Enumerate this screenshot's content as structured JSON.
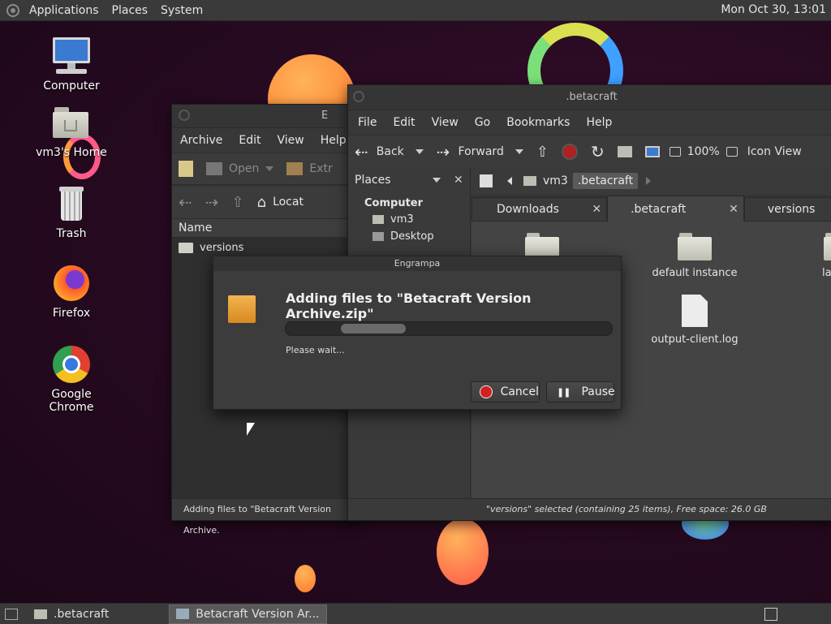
{
  "top_panel": {
    "menus": [
      "Applications",
      "Places",
      "System"
    ],
    "clock": "Mon Oct 30, 13:01"
  },
  "desktop_icons": [
    {
      "label": "Computer"
    },
    {
      "label": "vm3's Home"
    },
    {
      "label": "Trash"
    },
    {
      "label": "Firefox"
    },
    {
      "label": "Google Chrome"
    }
  ],
  "engrampa_window": {
    "title": "E",
    "menus": [
      "Archive",
      "Edit",
      "View",
      "Help"
    ],
    "toolbar": {
      "new": "",
      "open": "Open",
      "extract": "Extr"
    },
    "location_label": "Locat",
    "column_name": "Name",
    "row_name": "versions",
    "status": "Adding files to \"Betacraft Version Archive."
  },
  "caja_window": {
    "title": ".betacraft",
    "menus": [
      "File",
      "Edit",
      "View",
      "Go",
      "Bookmarks",
      "Help"
    ],
    "toolbar": {
      "back": "Back",
      "forward": "Forward",
      "zoom": "100%",
      "view_mode": "Icon View"
    },
    "sidebar": {
      "selector": "Places",
      "heading": "Computer",
      "items": [
        "vm3",
        "Desktop"
      ]
    },
    "path": [
      "vm3",
      ".betacraft"
    ],
    "tabs": [
      "Downloads",
      ".betacraft",
      "versions"
    ],
    "files": [
      "default instance",
      "output-client.log",
      "la"
    ],
    "status": "\"versions\" selected (containing 25 items), Free space: 26.0 GB"
  },
  "dialog": {
    "title": "Engrampa",
    "heading": "Adding files to \"Betacraft Version Archive.zip\"",
    "status": "Please wait...",
    "cancel": "Cancel",
    "pause": "Pause"
  },
  "taskbar": {
    "tasks": [
      ".betacraft",
      "Betacraft Version Ar..."
    ]
  },
  "colors": {
    "desktop_bg": "#2a0b22",
    "panel": "#3a3a3a",
    "accent_selected_path": "#5a5a5a",
    "blob_orange": "#ff8a3c",
    "ring_green": "#7be07a"
  }
}
